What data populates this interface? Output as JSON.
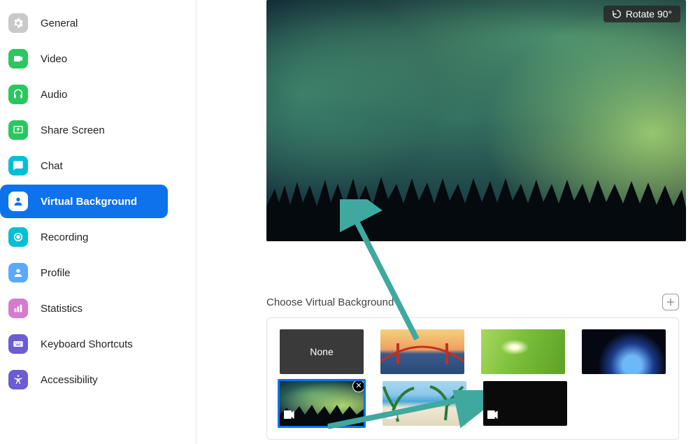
{
  "sidebar": {
    "items": [
      {
        "label": "General",
        "icon": "gear",
        "color": "#c9c9c9",
        "active": false
      },
      {
        "label": "Video",
        "icon": "video",
        "color": "#2ac760",
        "active": false
      },
      {
        "label": "Audio",
        "icon": "headphones",
        "color": "#2ac760",
        "active": false
      },
      {
        "label": "Share Screen",
        "icon": "share-screen",
        "color": "#2ac760",
        "active": false
      },
      {
        "label": "Chat",
        "icon": "chat",
        "color": "#00bfd6",
        "active": false
      },
      {
        "label": "Virtual Background",
        "icon": "user-bg",
        "color": "#0e72ed",
        "active": true
      },
      {
        "label": "Recording",
        "icon": "record",
        "color": "#00bfd6",
        "active": false
      },
      {
        "label": "Profile",
        "icon": "profile",
        "color": "#5ba8ff",
        "active": false
      },
      {
        "label": "Statistics",
        "icon": "stats",
        "color": "#d67bd0",
        "active": false
      },
      {
        "label": "Keyboard Shortcuts",
        "icon": "keyboard",
        "color": "#6b5cd6",
        "active": false
      },
      {
        "label": "Accessibility",
        "icon": "accessibility",
        "color": "#6b5cd6",
        "active": false
      }
    ]
  },
  "preview": {
    "rotate_label": "Rotate 90°"
  },
  "gallery": {
    "title": "Choose Virtual Background",
    "none_label": "None",
    "thumbnails": [
      {
        "kind": "none",
        "label": "None",
        "video": false,
        "selected": false,
        "removable": false
      },
      {
        "kind": "bridge",
        "video": false,
        "selected": false,
        "removable": false
      },
      {
        "kind": "grass",
        "video": false,
        "selected": false,
        "removable": false
      },
      {
        "kind": "earth",
        "video": false,
        "selected": false,
        "removable": false
      },
      {
        "kind": "aurora",
        "video": true,
        "selected": true,
        "removable": true
      },
      {
        "kind": "beach",
        "video": true,
        "selected": false,
        "removable": false
      },
      {
        "kind": "black",
        "video": true,
        "selected": false,
        "removable": false
      }
    ]
  },
  "annotation_color": "#3fa9a0"
}
